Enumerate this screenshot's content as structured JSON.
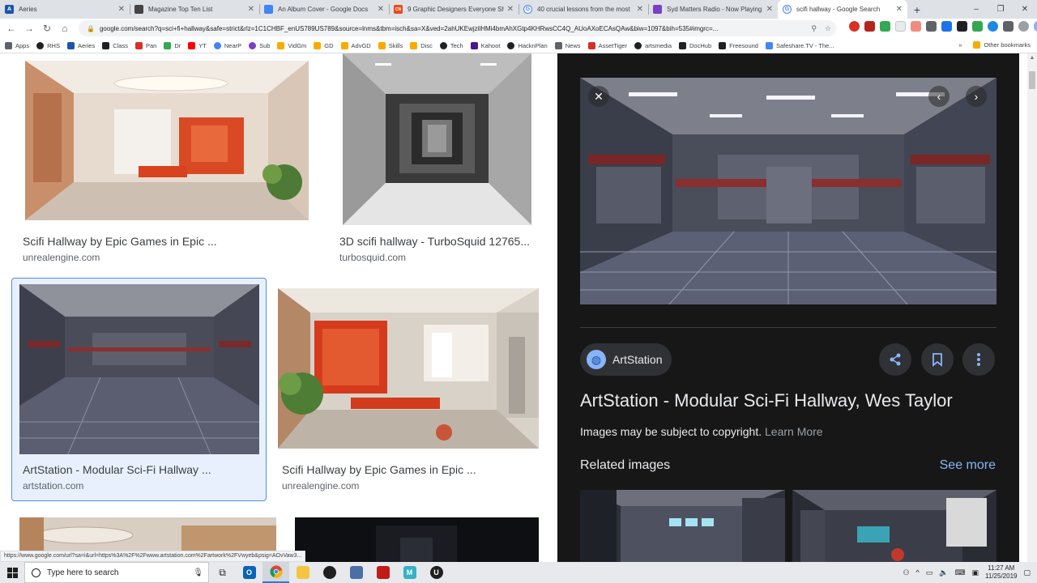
{
  "browser": {
    "tabs": [
      {
        "title": "Aeries",
        "favicon": "aeries-icon",
        "color": "#1a56a8",
        "glyph": "A"
      },
      {
        "title": "Magazine Top Ten List",
        "favicon": "doc-icon",
        "color": "#444444",
        "glyph": ""
      },
      {
        "title": "An Album Cover - Google Docs",
        "favicon": "docs-icon",
        "color": "#4285f4",
        "glyph": ""
      },
      {
        "title": "9 Graphic Designers Everyone Sh",
        "favicon": "cnn-icon",
        "color": "#e84a1a",
        "glyph": "CN"
      },
      {
        "title": "40 crucial lessons from the most",
        "favicon": "google-icon",
        "color": "#4285f4",
        "glyph": "G"
      },
      {
        "title": "Syd Matters Radio - Now Playing",
        "favicon": "music-icon",
        "color": "#7b3fc4",
        "glyph": ""
      },
      {
        "title": "scifi hallway - Google Search",
        "favicon": "google-icon",
        "color": "#4285f4",
        "glyph": "G"
      }
    ],
    "active_tab_index": 6,
    "new_tab_label": "+",
    "url": "google.com/search?q=sci+fi+hallway&safe=strict&rlz=1C1CHBF_enUS789US789&source=lnms&tbm=isch&sa=X&ved=2ahUKEwjzilHMi4bmAhXGtp4KHRwsCC4Q_AUoAXoECAsQAw&biw=1097&bih=535#imgrc=...",
    "window_controls": [
      "–",
      "❐",
      "✕"
    ]
  },
  "bookmarks": {
    "items": [
      {
        "label": "Apps",
        "color": "#5f6368"
      },
      {
        "label": "RHS",
        "color": "#202124"
      },
      {
        "label": "Aeries",
        "color": "#1a56a8"
      },
      {
        "label": "Class",
        "color": "#202124"
      },
      {
        "label": "Pan",
        "color": "#d93025"
      },
      {
        "label": "Dr",
        "color": "#34a853"
      },
      {
        "label": "YT",
        "color": "#ff0000"
      },
      {
        "label": "NearP",
        "color": "#4285f4"
      },
      {
        "label": "Sub",
        "color": "#7b3fc4"
      },
      {
        "label": "VidGm",
        "color": "#f9ab00"
      },
      {
        "label": "GD",
        "color": "#f9ab00"
      },
      {
        "label": "AdvGD",
        "color": "#f9ab00"
      },
      {
        "label": "Skills",
        "color": "#f9ab00"
      },
      {
        "label": "Disc",
        "color": "#f9ab00"
      },
      {
        "label": "Tech",
        "color": "#202124"
      },
      {
        "label": "Kahoot",
        "color": "#46178f"
      },
      {
        "label": "HacknPlan",
        "color": "#202124"
      },
      {
        "label": "News",
        "color": "#5f6368"
      },
      {
        "label": "AssetTiger",
        "color": "#d93025"
      },
      {
        "label": "artsmedia",
        "color": "#202124"
      },
      {
        "label": "DocHub",
        "color": "#202124"
      },
      {
        "label": "Freesound",
        "color": "#202124"
      },
      {
        "label": "Safeshare.TV - The...",
        "color": "#4285f4"
      }
    ],
    "overflow": "»",
    "other": "Other bookmarks"
  },
  "results": [
    {
      "title": "Scifi Hallway by Epic Games in Epic ...",
      "domain": "unrealengine.com"
    },
    {
      "title": "3D scifi hallway - TurboSquid 12765...",
      "domain": "turbosquid.com"
    },
    {
      "title": "ArtStation - Modular Sci-Fi Hallway ...",
      "domain": "artstation.com"
    },
    {
      "title": "Scifi Hallway by Epic Games in Epic ...",
      "domain": "unrealengine.com"
    }
  ],
  "panel": {
    "source": "ArtStation",
    "title": "ArtStation - Modular Sci-Fi Hallway, Wes Taylor",
    "copyright": "Images may be subject to copyright.",
    "learn_more": "Learn More",
    "related": "Related images",
    "see_more": "See more",
    "close": "✕",
    "prev": "‹",
    "next": "›"
  },
  "status_url": "https://www.google.com/url?sa=i&url=https%3A%2F%2Fwww.artstation.com%2Fartwork%2FVwyeb&psig=AOvVaw3...",
  "taskbar": {
    "search_placeholder": "Type here to search",
    "time": "11:27 AM",
    "date": "11/25/2019"
  }
}
